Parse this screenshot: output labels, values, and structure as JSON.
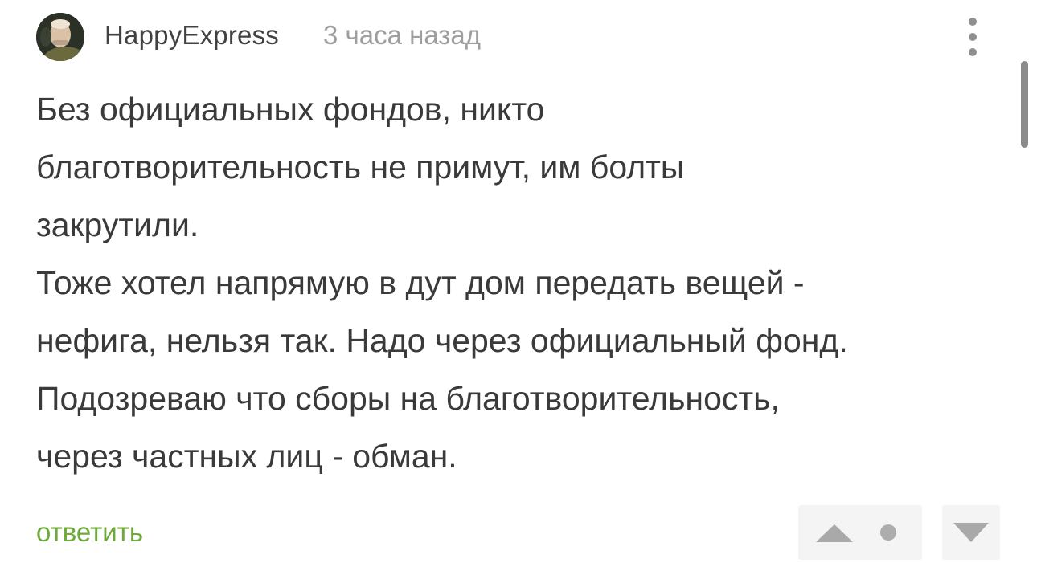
{
  "comment": {
    "author": "HappyExpress",
    "time": "3 часа назад",
    "body_lines": [
      "Без официальных фондов, никто",
      "благотворительность не примут, им болты",
      "закрутили.",
      "Тоже хотел напрямую в дут дом передать вещей -",
      "нефига, нельзя так. Надо через официальный фонд.",
      "Подозреваю что сборы на благотворительность,",
      "через частных лиц - обман."
    ],
    "reply_label": "ответить"
  },
  "icons": {
    "menu": "more-vertical-icon",
    "upvote": "triangle-up-icon",
    "downvote": "triangle-down-icon",
    "rating": "dot-icon"
  },
  "colors": {
    "text": "#3a3a3a",
    "meta": "#9e9e9e",
    "reply": "#6eaa3a",
    "vote_bg": "#f4f4f4",
    "vote_icon": "#a9a9a9"
  }
}
